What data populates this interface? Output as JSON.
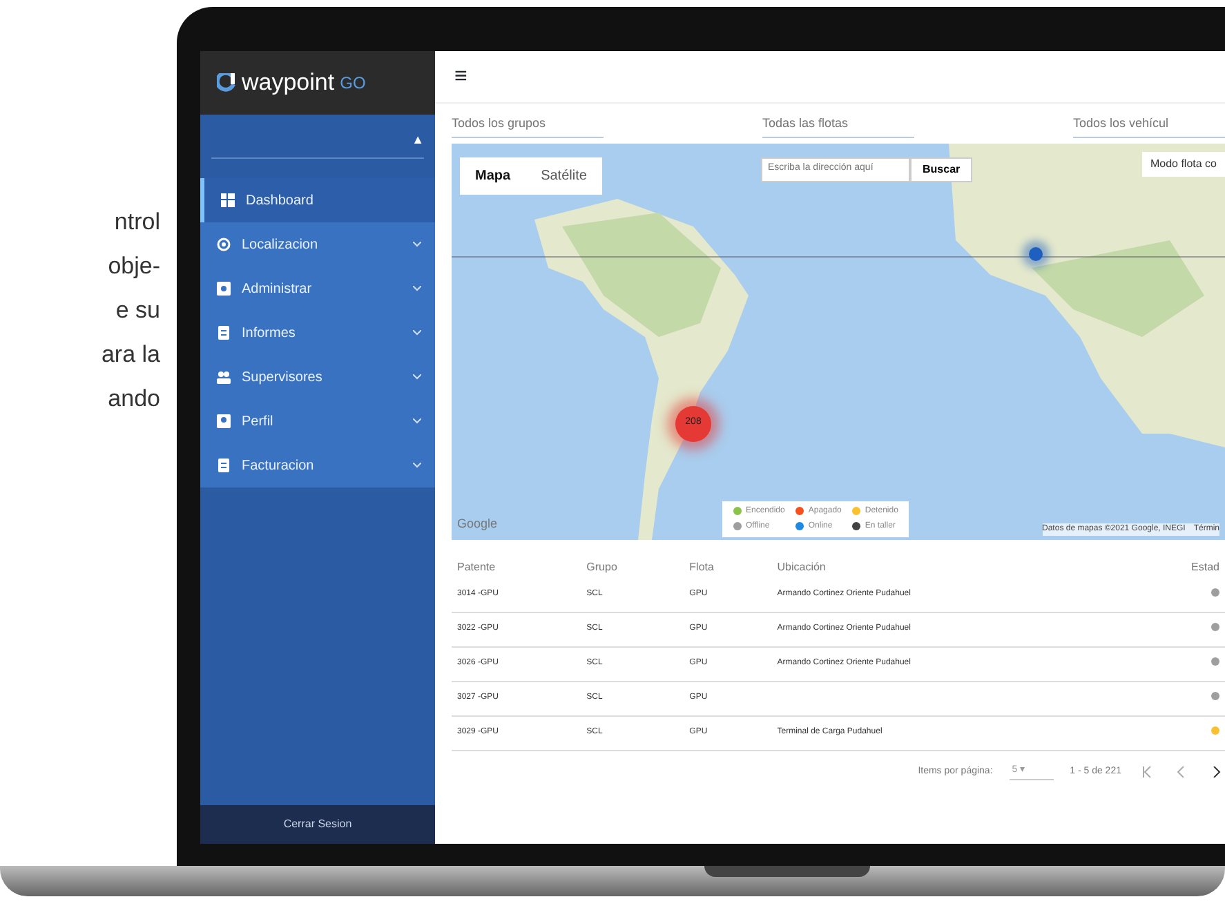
{
  "intro_text_lines": [
    "ntrol",
    "obje-",
    "e  su",
    "ara la",
    "ando"
  ],
  "sidebar": {
    "logo_main": "waypoint",
    "logo_accent": "GO",
    "items": [
      {
        "label": "Dashboard",
        "kind": "dashboard",
        "selected": true
      },
      {
        "label": "Localizacion",
        "kind": "location",
        "selected": false
      },
      {
        "label": "Administrar",
        "kind": "gear",
        "selected": false
      },
      {
        "label": "Informes",
        "kind": "doc",
        "selected": false
      },
      {
        "label": "Supervisores",
        "kind": "people",
        "selected": false
      },
      {
        "label": "Perfil",
        "kind": "person",
        "selected": false
      },
      {
        "label": "Facturacion",
        "kind": "doc",
        "selected": false
      }
    ],
    "account_select": {
      "caret": "▲"
    },
    "logout": "Cerrar Sesion"
  },
  "toolbar": {
    "menu_glyph": "≡"
  },
  "filters": [
    {
      "placeholder": "Todos los grupos"
    },
    {
      "placeholder": "Todas las flotas"
    },
    {
      "placeholder": "Todos los vehícul"
    }
  ],
  "map": {
    "map_types": [
      {
        "label": "Mapa",
        "selected": true
      },
      {
        "label": "Satélite",
        "selected": false
      }
    ],
    "search": {
      "placeholder": "Escriba la dirección aquí",
      "button": "Buscar"
    },
    "mode_button": "Modo flota co",
    "cluster_label": "208",
    "legend": [
      {
        "label": "Encendido",
        "color": "#8bc34a"
      },
      {
        "label": "Apagado",
        "color": "#f4511e"
      },
      {
        "label": "Detenido",
        "color": "#fbc02d"
      },
      {
        "label": "Offline",
        "color": "#9e9e9e"
      },
      {
        "label": "Online",
        "color": "#1e88e5"
      },
      {
        "label": "En taller",
        "color": "#424242"
      }
    ],
    "google": "Google",
    "attribution": "Datos de mapas ©2021 Google, INEGI",
    "terms": "Términ"
  },
  "table": {
    "columns": [
      "Patente",
      "Grupo",
      "Flota",
      "Ubicación",
      "Estad"
    ],
    "rows": [
      {
        "patente": "3014 -GPU",
        "grupo": "SCL",
        "flota": "GPU",
        "ubicacion": "Armando Cortinez Oriente Pudahuel",
        "color": "#9e9e9e"
      },
      {
        "patente": "3022 -GPU",
        "grupo": "SCL",
        "flota": "GPU",
        "ubicacion": "Armando Cortinez Oriente Pudahuel",
        "color": "#9e9e9e"
      },
      {
        "patente": "3026 -GPU",
        "grupo": "SCL",
        "flota": "GPU",
        "ubicacion": "Armando Cortinez Oriente Pudahuel",
        "color": "#9e9e9e"
      },
      {
        "patente": "3027 -GPU",
        "grupo": "SCL",
        "flota": "GPU",
        "ubicacion": "",
        "color": "#9e9e9e"
      },
      {
        "patente": "3029 -GPU",
        "grupo": "SCL",
        "flota": "GPU",
        "ubicacion": "Terminal de Carga Pudahuel",
        "color": "#fbc02d"
      }
    ]
  },
  "paginator": {
    "label": "Items por página:",
    "page_size": "5",
    "caret": "▾",
    "range": "1 - 5 de 221"
  }
}
